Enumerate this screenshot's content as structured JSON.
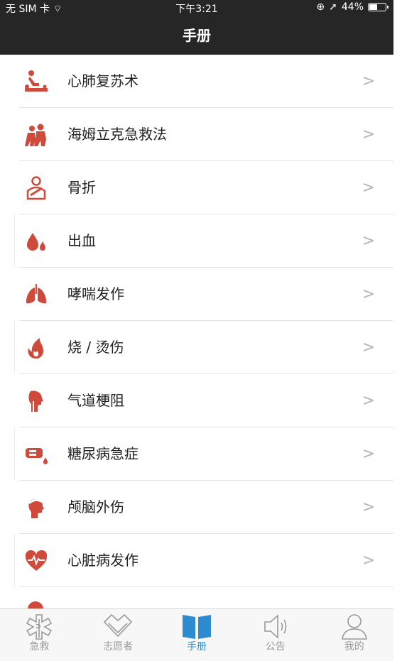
{
  "status_bar": {
    "carrier": "无 SIM 卡",
    "time": "下午3:21",
    "battery": "44%"
  },
  "nav": {
    "title": "手册"
  },
  "list": {
    "items": [
      {
        "label": "心肺复苏术",
        "icon": "cpr-icon"
      },
      {
        "label": "海姆立克急救法",
        "icon": "heimlich-icon"
      },
      {
        "label": "骨折",
        "icon": "fracture-icon"
      },
      {
        "label": "出血",
        "icon": "blood-drop-icon"
      },
      {
        "label": "哮喘发作",
        "icon": "lungs-icon"
      },
      {
        "label": "烧 / 烫伤",
        "icon": "flame-icon"
      },
      {
        "label": "气道梗阻",
        "icon": "airway-icon"
      },
      {
        "label": "糖尿病急症",
        "icon": "glucose-icon"
      },
      {
        "label": "颅脑外伤",
        "icon": "head-injury-icon"
      },
      {
        "label": "心脏病发作",
        "icon": "heart-pulse-icon"
      }
    ],
    "chevron": ">"
  },
  "tabbar": {
    "tabs": [
      {
        "label": "急救",
        "icon": "emergency-star-icon"
      },
      {
        "label": "志愿者",
        "icon": "heart-outline-icon"
      },
      {
        "label": "手册",
        "icon": "book-icon",
        "active": true
      },
      {
        "label": "公告",
        "icon": "speaker-icon"
      },
      {
        "label": "我的",
        "icon": "person-icon"
      }
    ]
  },
  "colors": {
    "accent_red": "#cf4a3a",
    "tab_active": "#2d8ccf",
    "tab_inactive": "#9a9a9a",
    "nav_bg": "#262626"
  }
}
